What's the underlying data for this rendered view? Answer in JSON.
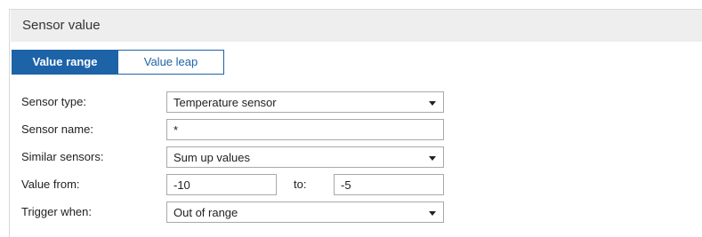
{
  "panel": {
    "title": "Sensor value"
  },
  "tabs": [
    {
      "label": "Value range",
      "active": true
    },
    {
      "label": "Value leap",
      "active": false
    }
  ],
  "form": {
    "sensor_type": {
      "label": "Sensor type:",
      "value": "Temperature sensor"
    },
    "sensor_name": {
      "label": "Sensor name:",
      "value": "*"
    },
    "similar_sensors": {
      "label": "Similar sensors:",
      "value": "Sum up values"
    },
    "value_from": {
      "label": "Value from:",
      "from_value": "-10",
      "to_label": "to:",
      "to_value": "-5"
    },
    "trigger_when": {
      "label": "Trigger when:",
      "value": "Out of range"
    }
  },
  "colors": {
    "accent": "#1d63a8",
    "header_bg": "#eeeeee",
    "border": "#a9a9a9"
  },
  "icons": {
    "dropdown": "chevron-down-icon"
  }
}
